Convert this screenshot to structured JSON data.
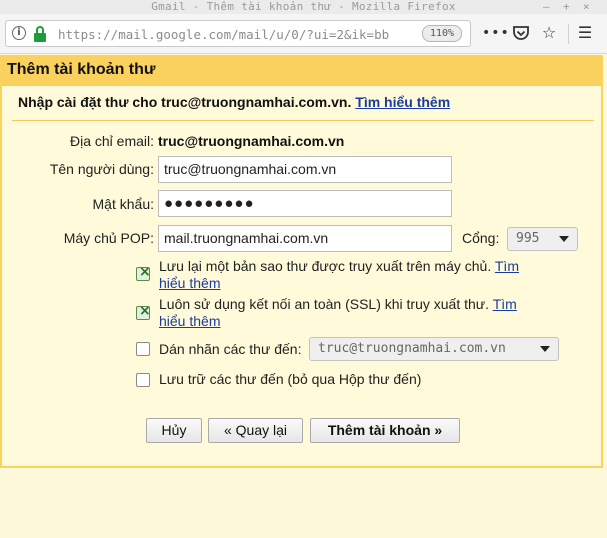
{
  "window": {
    "title": "Gmail - Thêm tài khoản thư - Mozilla Firefox",
    "controls": [
      "–",
      "+",
      "×"
    ]
  },
  "browser": {
    "url": "https://mail.google.com/mail/u/0/?ui=2&ik=bb",
    "zoom": "110%",
    "icons": [
      "more-icon",
      "pocket-icon",
      "bookmark-star-icon",
      "hamburger-menu-icon"
    ]
  },
  "dialog": {
    "title": "Thêm tài khoản thư",
    "instruction_prefix": "Nhập cài đặt thư cho truc@truongnamhai.com.vn.",
    "learn_more": "Tìm hiểu thêm",
    "fields": {
      "email_label": "Địa chỉ email:",
      "email_value": "truc@truongnamhai.com.vn",
      "username_label": "Tên người dùng:",
      "username_value": "truc@truongnamhai.com.vn",
      "password_label": "Mật khẩu:",
      "password_value": "●●●●●●●●●",
      "pop_label": "Máy chủ POP:",
      "pop_value": "mail.truongnamhai.com.vn",
      "port_label": "Cổng:",
      "port_value": "995"
    },
    "options": {
      "leave_copy_text": "Lưu lại một bản sao thư được truy xuất trên máy chủ.",
      "leave_copy_link_1": "Tìm",
      "leave_copy_link_2": "hiểu thêm",
      "ssl_text": "Luôn sử dụng kết nối an toàn (SSL) khi truy xuất thư.",
      "ssl_link_1": "Tìm",
      "ssl_link_2": "hiểu thêm",
      "label_text": "Dán nhãn các thư đến:",
      "label_select_value": "truc@truongnamhai.com.vn",
      "archive_text": "Lưu trữ các thư đến (bỏ qua Hộp thư đến)"
    },
    "buttons": {
      "cancel": "Hủy",
      "back": "« Quay lại",
      "add": "Thêm tài khoản »"
    }
  }
}
